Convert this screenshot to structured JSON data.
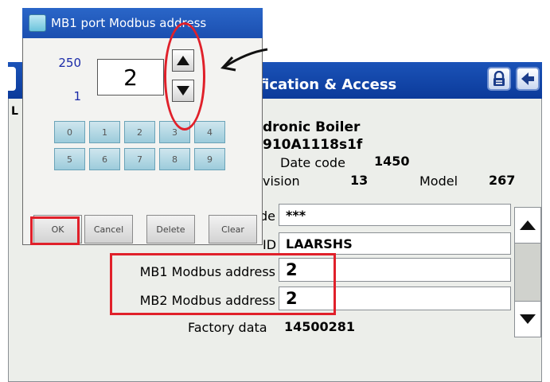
{
  "main": {
    "title": "fication & Access",
    "info": {
      "line1": "dronic Boiler",
      "line2": "910A1118s1f",
      "date_code_label": "Date code",
      "date_code_value": "1450",
      "revision_label": "vision",
      "revision_value": "13",
      "model_label": "Model",
      "model_value": "267"
    },
    "fields": {
      "code_label": "de",
      "code_value": "***",
      "oem_id_label": "ID",
      "oem_id_value": "LAARSHS",
      "mb1_label": "MB1 Modbus address",
      "mb1_value": "2",
      "mb2_label": "MB2 Modbus address",
      "mb2_value": "2",
      "factory_label": "Factory data",
      "factory_value": "14500281"
    },
    "left_letters": {
      "a": "L",
      "b": "L"
    }
  },
  "dialog": {
    "title": "MB1 port Modbus address",
    "range_max": "250",
    "range_min": "1",
    "value": "2",
    "digits": [
      "0",
      "1",
      "2",
      "3",
      "4",
      "5",
      "6",
      "7",
      "8",
      "9"
    ],
    "buttons": {
      "ok": "OK",
      "cancel": "Cancel",
      "delete": "Delete",
      "clear": "Clear"
    }
  },
  "icons": {
    "lock": "lock-icon",
    "back": "back-arrow-icon",
    "up": "up-arrow-icon",
    "down": "down-arrow-icon",
    "dialog_app": "app-icon"
  },
  "colors": {
    "titlebar": "#0b3a9a",
    "annotation": "#e0202a",
    "digit_key": "#9ccbdb"
  }
}
